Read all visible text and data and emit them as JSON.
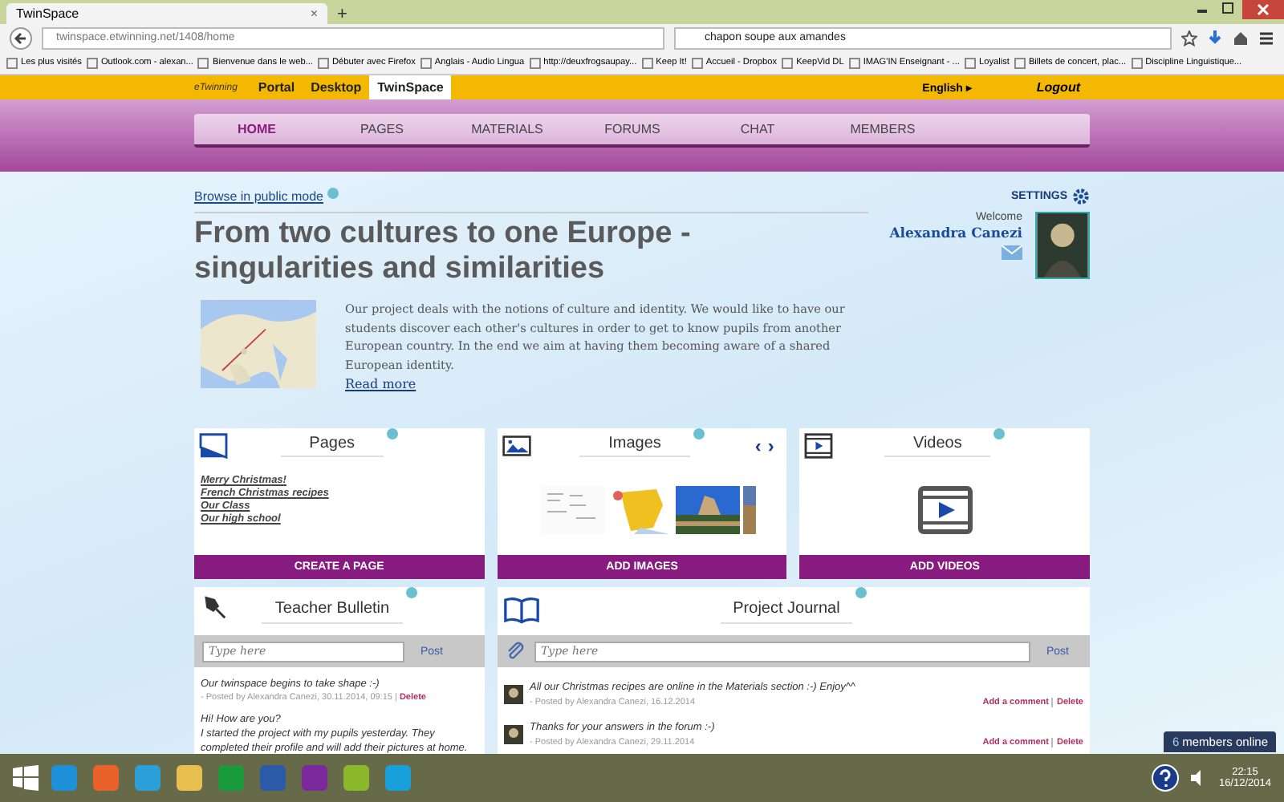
{
  "browser": {
    "tabs": [
      {
        "label": "TwinSpace",
        "selected": true,
        "close": "×"
      }
    ],
    "new_tab": "+",
    "url": "twinspace.etwinning.net/1408/home",
    "search": "chapon soupe aux amandes",
    "bookmarks": [
      "Les plus visités",
      "Outlook.com - alexan...",
      "Bienvenue dans le web...",
      "Débuter avec Firefox",
      "Anglais - Audio Lingua",
      "http://deuxfrogsaupay...",
      "Keep It!",
      "Accueil - Dropbox",
      "KeepVid DL",
      "IMAG'IN Enseignant - ...",
      "Loyalist",
      "Billets de concert, plac...",
      "Discipline Linguistique..."
    ]
  },
  "top_bar": {
    "logo": "eTwinning",
    "links": [
      {
        "label": "Portal",
        "selected": false
      },
      {
        "label": "Desktop",
        "selected": false
      },
      {
        "label": "TwinSpace",
        "selected": true
      }
    ],
    "language": "English",
    "language_arrow": "▸",
    "logout": "Logout"
  },
  "nav": [
    {
      "label": "HOME",
      "selected": true
    },
    {
      "label": "PAGES",
      "selected": false
    },
    {
      "label": "MATERIALS",
      "selected": false
    },
    {
      "label": "FORUMS",
      "selected": false
    },
    {
      "label": "CHAT",
      "selected": false
    },
    {
      "label": "MEMBERS",
      "selected": false
    }
  ],
  "browse_link": "Browse in public mode",
  "settings": "SETTINGS",
  "welcome": "Welcome",
  "user_name": "Alexandra Canezi",
  "title": "From two cultures to one Europe - singularities and similarities",
  "description": "Our project deals with the notions of culture and identity. We would like to have our students discover each other's cultures in order to get to know pupils from another European country. In the end we aim at having them becoming aware of a shared European identity.",
  "read_more": "Read more",
  "pages_card": {
    "title": "Pages",
    "links": [
      "Merry Christmas!",
      "French Christmas recipes",
      "Our Class",
      "Our high school"
    ],
    "button": "CREATE A PAGE"
  },
  "images_card": {
    "title": "Images",
    "prev": "‹",
    "next": "›",
    "button": "ADD IMAGES"
  },
  "videos_card": {
    "title": "Videos",
    "button": "ADD VIDEOS"
  },
  "bulletin": {
    "title": "Teacher Bulletin",
    "placeholder": "Type here",
    "post": "Post",
    "posts": [
      {
        "text": "Our twinspace begins to take shape :-)",
        "meta": "- Posted by Alexandra Canezi, 30.11.2014, 09:15 |",
        "delete": "Delete"
      },
      {
        "text": "Hi! How are you?\nI started the project with my pupils yesterday. They completed their profile and will add their pictures at home."
      }
    ]
  },
  "journal": {
    "title": "Project Journal",
    "placeholder": "Type here",
    "post": "Post",
    "entries": [
      {
        "text": "All our Christmas recipes are online in the Materials section :-) Enjoy^^",
        "meta": "- Posted by Alexandra Canezi, 16.12.2014",
        "comment": "Add a comment",
        "delete": "Delete"
      },
      {
        "text": "Thanks for your answers in the forum :-)",
        "meta": "- Posted by Alexandra Canezi, 29.11.2014",
        "comment": "Add a comment",
        "delete": "Delete"
      }
    ]
  },
  "members_online": {
    "count": "6",
    "label": "members online"
  },
  "taskbar": {
    "time": "22:15",
    "date": "16/12/2014"
  }
}
